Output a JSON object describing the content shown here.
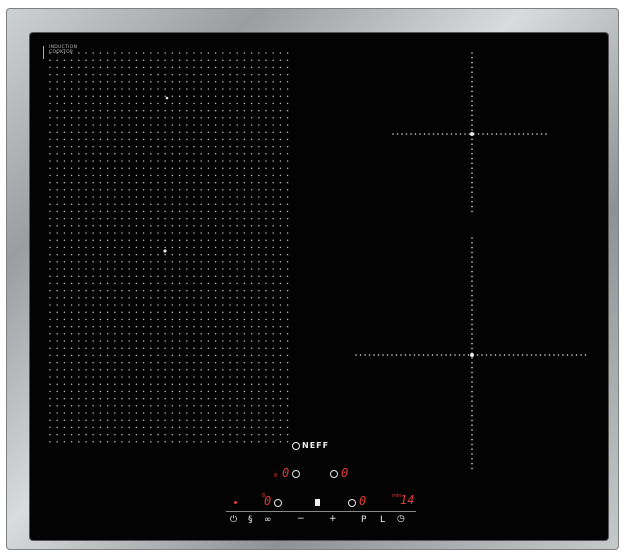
{
  "appliance": {
    "badge_text": "INDUCTION\nCOOKTOP",
    "brand": "NEFF"
  },
  "controls": {
    "row1": {
      "left_small": "8",
      "left_digit": "0",
      "right_digit": "0"
    },
    "row2": {
      "left_small": "8",
      "left_digit": "0",
      "right_digit": "0",
      "timer_small": "min",
      "timer_digits": "14"
    },
    "buttons": [
      {
        "id": "power",
        "label": "⏻"
      },
      {
        "id": "flex",
        "label": "§"
      },
      {
        "id": "link",
        "label": "∞"
      },
      {
        "id": "minus",
        "label": "−"
      },
      {
        "id": "plus",
        "label": "+"
      },
      {
        "id": "p",
        "label": "P"
      },
      {
        "id": "l",
        "label": "L"
      },
      {
        "id": "timer",
        "label": "◷"
      }
    ]
  },
  "colors": {
    "glass": "#030303",
    "display_red": "#e23a3a",
    "frame_steel": "#b5b8ba"
  }
}
